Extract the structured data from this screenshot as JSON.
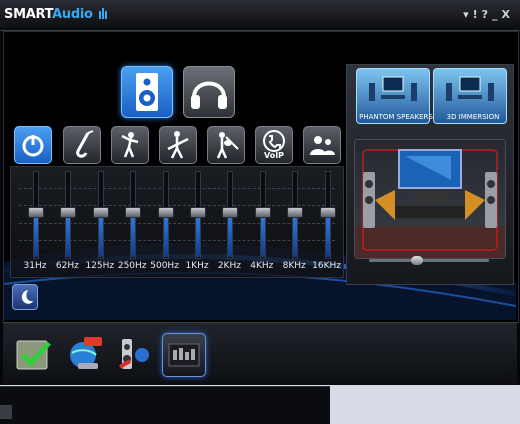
{
  "app": {
    "logo_main": "SMART",
    "logo_accent": "Audio"
  },
  "window_controls": {
    "menu": "▾",
    "help": "!",
    "question": "?",
    "minimize": "_",
    "close": "X"
  },
  "devices": [
    {
      "name": "speaker",
      "selected": true
    },
    {
      "name": "headphone",
      "selected": false
    }
  ],
  "effects": [
    {
      "name": "power",
      "icon": "power-icon",
      "active": true
    },
    {
      "name": "saxophone",
      "icon": "saxophone-icon"
    },
    {
      "name": "dancer",
      "icon": "dancer-icon"
    },
    {
      "name": "guitarist",
      "icon": "guitarist-icon"
    },
    {
      "name": "violinist",
      "icon": "violinist-icon"
    },
    {
      "name": "voip",
      "icon": "phone-icon",
      "label": "VoIP"
    },
    {
      "name": "conference",
      "icon": "users-icon"
    }
  ],
  "equalizer": {
    "bands": [
      {
        "label": "31Hz",
        "level": 0.0
      },
      {
        "label": "62Hz",
        "level": 0.0
      },
      {
        "label": "125Hz",
        "level": 0.0
      },
      {
        "label": "250Hz",
        "level": 0.0
      },
      {
        "label": "500Hz",
        "level": 0.0
      },
      {
        "label": "1KHz",
        "level": 0.0
      },
      {
        "label": "2KHz",
        "level": 0.0
      },
      {
        "label": "4KHz",
        "level": 0.0
      },
      {
        "label": "8KHz",
        "level": 0.0
      },
      {
        "label": "16KHz",
        "level": 0.0
      }
    ]
  },
  "modes": {
    "phantom": "PHANTOM SPEAKERS",
    "immersion": "3D IMMERSION"
  },
  "balance": {
    "position": 0.5
  },
  "taskbar": [
    {
      "name": "settings",
      "icon": "check-settings-icon"
    },
    {
      "name": "voip",
      "icon": "voip-globe-icon"
    },
    {
      "name": "speaker-test",
      "icon": "speaker-mic-icon"
    },
    {
      "name": "equalizer",
      "icon": "equalizer-icon",
      "active": true
    }
  ],
  "colors": {
    "accent": "#2a78d8",
    "background": "#05070c"
  }
}
